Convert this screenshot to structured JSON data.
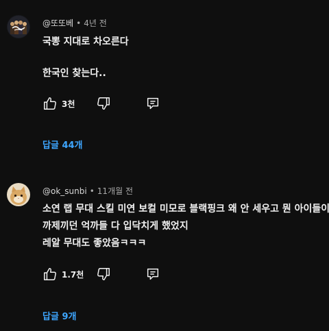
{
  "comments": [
    {
      "author": "@또또베",
      "separator": "•",
      "time": "4년 전",
      "lines": [
        "국뽕 지대로 차오른다",
        "",
        "한국인 찾는다.."
      ],
      "like_count": "3천",
      "replies_label": "답글 44개",
      "avatar_icon": "avatar-band-image"
    },
    {
      "author": "@ok_sunbi",
      "separator": "•",
      "time": "11개월 전",
      "lines": [
        "소연 랩 무대 스킬 미연 보컬 미모로 블랙핑크 왜 안 세우고 뭔 아이들이",
        "까제끼던 억까들 다 입닥치게 했었지",
        "레알 무대도 좋았음ㅋㅋㅋ"
      ],
      "like_count": "1.7천",
      "replies_label": "답글 9개",
      "avatar_icon": "avatar-cat-image"
    }
  ],
  "colors": {
    "background": "#0f0f0f",
    "text": "#f1f1f1",
    "meta": "#aaaaaa",
    "link": "#3ea6ff"
  },
  "icons": [
    "thumbs-up-icon",
    "thumbs-down-icon",
    "reply-icon"
  ]
}
